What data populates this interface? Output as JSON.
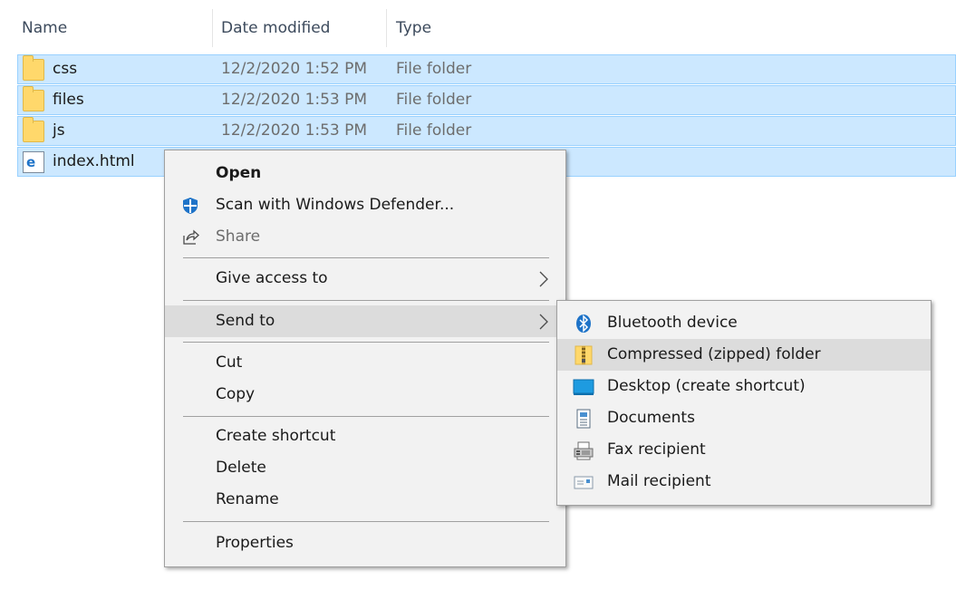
{
  "columns": {
    "name": "Name",
    "date": "Date modified",
    "type": "Type"
  },
  "files": [
    {
      "name": "css",
      "date": "12/2/2020 1:52 PM",
      "type": "File folder",
      "icon": "folder-icon"
    },
    {
      "name": "files",
      "date": "12/2/2020 1:53 PM",
      "type": "File folder",
      "icon": "folder-icon"
    },
    {
      "name": "js",
      "date": "12/2/2020 1:53 PM",
      "type": "File folder",
      "icon": "folder-icon"
    },
    {
      "name": "index.html",
      "date": "",
      "type": "",
      "icon": "html-file-icon"
    }
  ],
  "context_menu": {
    "open": "Open",
    "scan": "Scan with Windows Defender...",
    "share": "Share",
    "give_access": "Give access to",
    "send_to": "Send to",
    "cut": "Cut",
    "copy": "Copy",
    "create_shortcut": "Create shortcut",
    "delete": "Delete",
    "rename": "Rename",
    "properties": "Properties"
  },
  "send_to_menu": {
    "bluetooth": "Bluetooth device",
    "compressed": "Compressed (zipped) folder",
    "desktop": "Desktop (create shortcut)",
    "documents": "Documents",
    "fax": "Fax recipient",
    "mail": "Mail recipient"
  },
  "colors": {
    "selection": "#cce8ff",
    "selection_border": "#99d1ff",
    "menu_bg": "#f2f2f2",
    "menu_hover": "#dcdcdc"
  }
}
